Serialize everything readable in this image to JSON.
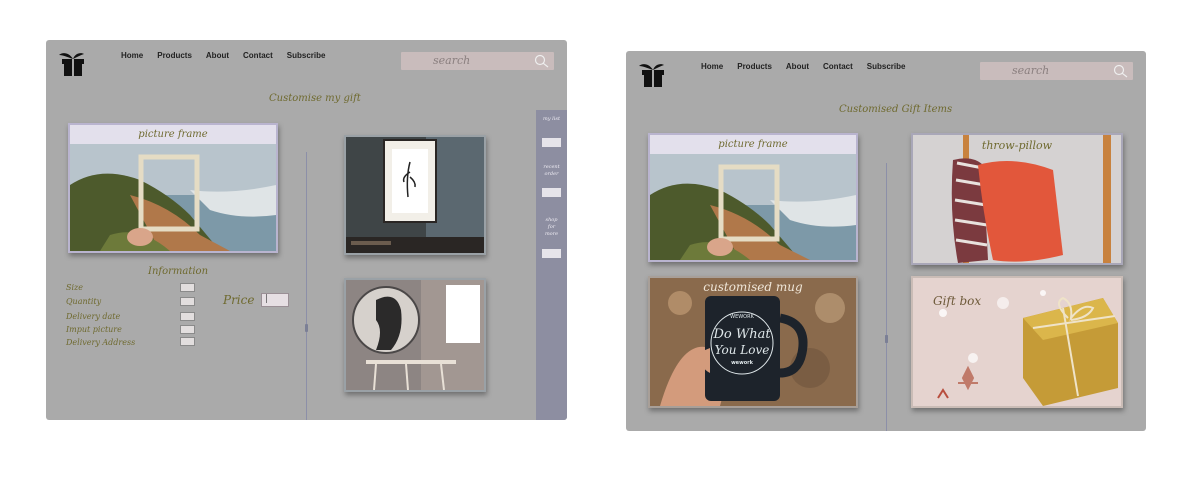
{
  "left": {
    "nav": [
      "Home",
      "Products",
      "About",
      "Contact",
      "Subscribe"
    ],
    "search_placeholder": "search",
    "heading": "Customise my gift",
    "card_picture_frame": "picture frame",
    "info_heading": "Information",
    "form_fields": [
      "Size",
      "Quantity",
      "Delivery date",
      "Imput picture",
      "Delivery Address"
    ],
    "price_label": "Price",
    "price_value": "|",
    "sidebar": {
      "my_list": "my list",
      "recent_order": "recent order",
      "shop_more": "shop for more"
    }
  },
  "right": {
    "nav": [
      "Home",
      "Products",
      "About",
      "Contact",
      "Subscribe"
    ],
    "search_placeholder": "search",
    "heading": "Customised Gift Items",
    "cards": [
      "picture frame",
      "throw-pillow",
      "customised mug",
      "Gift box"
    ],
    "mug_text": {
      "brand_top": "WEWORK",
      "line1": "Do What",
      "line2": "You Love",
      "brand": "wework"
    }
  },
  "colors": {
    "panel": "#aaaaaa",
    "accent_text": "#6f6a2f",
    "label_bar": "#e3e0ec",
    "sidebar": "#8d8ea1"
  },
  "icons": {
    "logo": "gift-icon",
    "search": "search-icon"
  }
}
